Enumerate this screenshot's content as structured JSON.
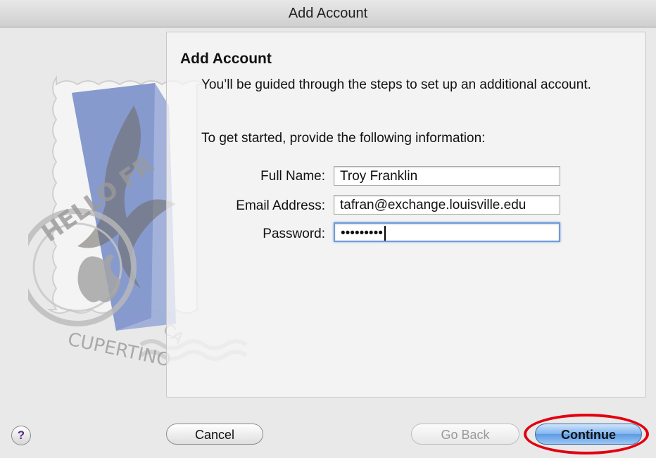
{
  "window": {
    "title": "Add Account"
  },
  "content": {
    "heading": "Add Account",
    "intro": "You’ll be guided through the steps to set up an additional account.",
    "prompt": "To get started, provide the following information:"
  },
  "form": {
    "full_name_label": "Full Name:",
    "full_name_value": "Troy Franklin",
    "email_label": "Email Address:",
    "email_value": "tafran@exchange.louisville.edu",
    "password_label": "Password:",
    "password_value": "•••••••••"
  },
  "buttons": {
    "help": "?",
    "cancel": "Cancel",
    "go_back": "Go Back",
    "continue": "Continue"
  },
  "stamp_text": {
    "top": "HELLO FR",
    "bottom": "CUPERTINO",
    "side": "CA"
  },
  "icons": {
    "help": "question-mark-icon",
    "stamp": "mail-stamp-icon"
  },
  "colors": {
    "highlight": "#e20010",
    "focus_ring": "#6f9bd8",
    "primary_button": "#5b9be2"
  }
}
